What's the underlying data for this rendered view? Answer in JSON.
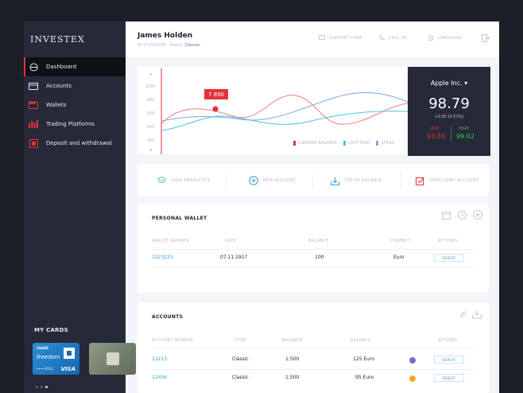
{
  "app": {
    "brand": "INVESTEX"
  },
  "sidebar": {
    "items": [
      {
        "label": "Dashboard",
        "icon": "dashboard-icon",
        "active": true
      },
      {
        "label": "Accounts",
        "icon": "accounts-icon",
        "active": false
      },
      {
        "label": "Wallets",
        "icon": "wallet-icon",
        "active": false
      },
      {
        "label": "Trading Platforms",
        "icon": "trading-icon",
        "active": false
      },
      {
        "label": "Deposit and withdrawal",
        "icon": "deposit-icon",
        "active": false
      }
    ],
    "cards_title": "MY CARDS",
    "card1": {
      "bank": "CHASE",
      "name": "freedom",
      "digits": "•••• 0112",
      "network": "VISA"
    }
  },
  "header": {
    "user_name": "James Holden",
    "user_id": "ID 172559248",
    "status_label": "Status:",
    "status_value": "Classic",
    "support": "SUPPORT CHAT",
    "call": "CALL US",
    "language": "LANGUAGE"
  },
  "chart_data": {
    "type": "line",
    "y_ticks": [
      "▲",
      "1000",
      "800",
      "600",
      "400",
      "200",
      "▼"
    ],
    "tooltip": "7 890",
    "series": [
      {
        "name": "CURRENT BALANCE",
        "color": "#f07d86"
      },
      {
        "name": "LAST YEAR",
        "color": "#47c6e6"
      },
      {
        "name": "SPEND",
        "color": "#7aa8e6"
      }
    ]
  },
  "stock": {
    "symbol": "Apple Inc. ▾",
    "price": "98.79",
    "change": "+0.92  (0.51%)",
    "low_label": "LOW",
    "low_value": "93.09",
    "high_label": "HIGH",
    "high_value": "99.02"
  },
  "quick_actions": {
    "analytics": "VIEW ANNALYTICS",
    "new_account": "NEW ACCOUNT",
    "top_up": "TOP UP BALANCE",
    "demo": "OPEN DEMO ACCOUNT"
  },
  "wallet": {
    "title": "PERSONAL WALLET",
    "columns": [
      "WALLET NUMBER",
      "DATE",
      "BALANCE",
      "CURENCY",
      "ACTIONS"
    ],
    "rows": [
      {
        "number": "1223223",
        "date": "07.11.1917",
        "balance": "100",
        "currency": "Euro",
        "action": "REPEAT"
      }
    ]
  },
  "accounts": {
    "title": "ACCOUNTS",
    "columns": [
      "ACCOUNT NUMBER",
      "TYPE",
      "BALANCE",
      "BALANCE",
      "ACTIONS"
    ],
    "rows": [
      {
        "number": "12213",
        "type": "Classic",
        "leverage": "1:500",
        "balance": "125 Euro",
        "action": "REPEAT",
        "dot": "#6b6fd6"
      },
      {
        "number": "12456",
        "type": "Classic",
        "leverage": "1:500",
        "balance": "95 Euro",
        "action": "REPEAT",
        "dot": "#f5a623"
      }
    ]
  }
}
